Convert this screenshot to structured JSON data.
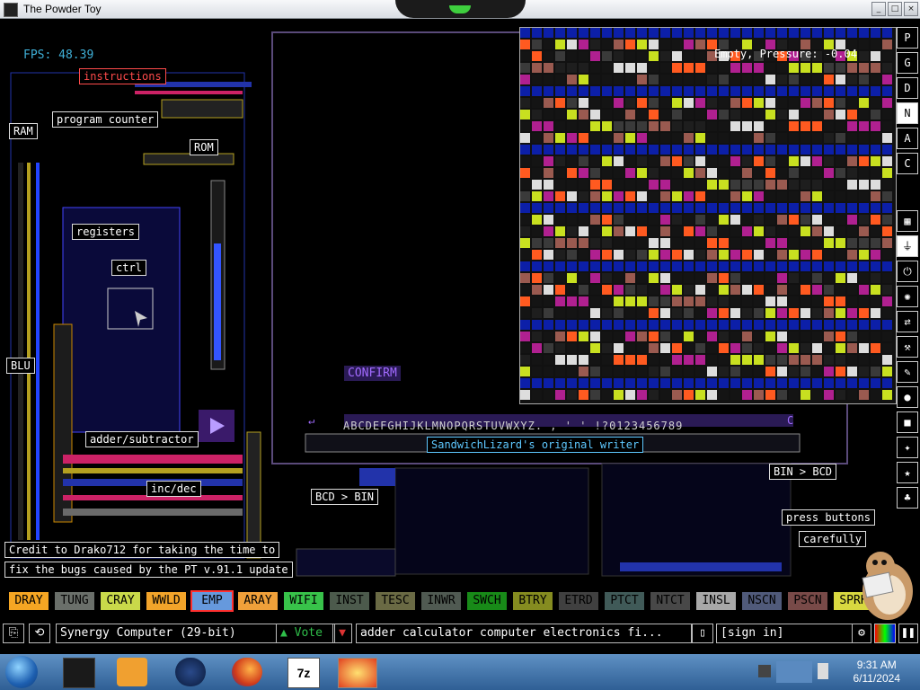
{
  "window": {
    "title": "The Powder Toy",
    "buttons": [
      "_",
      "□",
      "×"
    ]
  },
  "hud": {
    "fps": "FPS: 48.39",
    "pressure": "Empty, Pressure: -0.04"
  },
  "labels": {
    "instructions": "instructions",
    "program_counter": "program counter",
    "ram": "RAM",
    "rom": "ROM",
    "registers": "registers",
    "ctrl": "ctrl",
    "blu": "BLU",
    "adder": "adder/subtractor",
    "incdec": "inc/dec",
    "bcd_bin": "BCD > BIN",
    "bin_bcd": "BIN > BCD",
    "press1": "press buttons",
    "press2": "carefully",
    "writer": "SandwichLizard's original writer",
    "confirm": "CONFIRM",
    "alphabet": "ABCDEFGHIJKLMNOPQRSTUVWXYZ. , ' ' !?0123456789",
    "left_arrow": "↵",
    "c_btn": "C"
  },
  "credit": {
    "line1": "Credit to Drako712 for taking the time to",
    "line2": "fix the bugs caused by the PT v.91.1 update"
  },
  "right_menu": {
    "top": [
      "P",
      "G",
      "D",
      "N",
      "A",
      "C"
    ],
    "icons": [
      "grid-icon",
      "plug-icon",
      "power-icon",
      "explosive-icon",
      "arrows-icon",
      "hammer-icon",
      "pen-icon",
      "drop-icon",
      "wall-icon",
      "special-icon",
      "star-icon",
      "tree-icon",
      "pause-icon"
    ]
  },
  "elements": [
    {
      "name": "DRAY",
      "color": "#f5a623"
    },
    {
      "name": "TUNG",
      "color": "#6a6f6a"
    },
    {
      "name": "CRAY",
      "color": "#c9d94a"
    },
    {
      "name": "WWLD",
      "color": "#f2a42a"
    },
    {
      "name": "EMP",
      "color": "#6699dd",
      "selected": true
    },
    {
      "name": "ARAY",
      "color": "#f0a03a"
    },
    {
      "name": "WIFI",
      "color": "#38c24a"
    },
    {
      "name": "INST",
      "color": "#4c5a4c"
    },
    {
      "name": "TESC",
      "color": "#6a6a44"
    },
    {
      "name": "INWR",
      "color": "#505a52"
    },
    {
      "name": "SWCH",
      "color": "#188a18"
    },
    {
      "name": "BTRY",
      "color": "#858c20"
    },
    {
      "name": "ETRD",
      "color": "#404040"
    },
    {
      "name": "PTCT",
      "color": "#405a58"
    },
    {
      "name": "NTCT",
      "color": "#484848"
    },
    {
      "name": "INSL",
      "color": "#a8a8a8"
    },
    {
      "name": "NSCN",
      "color": "#505a7a"
    },
    {
      "name": "PSCN",
      "color": "#784a48"
    },
    {
      "name": "SPRK",
      "color": "#d8d840"
    }
  ],
  "bottom": {
    "save_name": "Synergy Computer (29-bit)",
    "vote": "Vote",
    "tags": "adder calculator computer electronics fi...",
    "signin": "[sign in]"
  },
  "taskbar": {
    "time": "9:31 AM",
    "date": "6/11/2024",
    "apps": [
      "media-icon",
      "firefox-icon",
      "7zip-icon",
      "powder-toy-icon"
    ]
  },
  "colors": {
    "accent": "#3fb0d8",
    "confirm": "#a26bff",
    "selected": "#ff3030"
  }
}
